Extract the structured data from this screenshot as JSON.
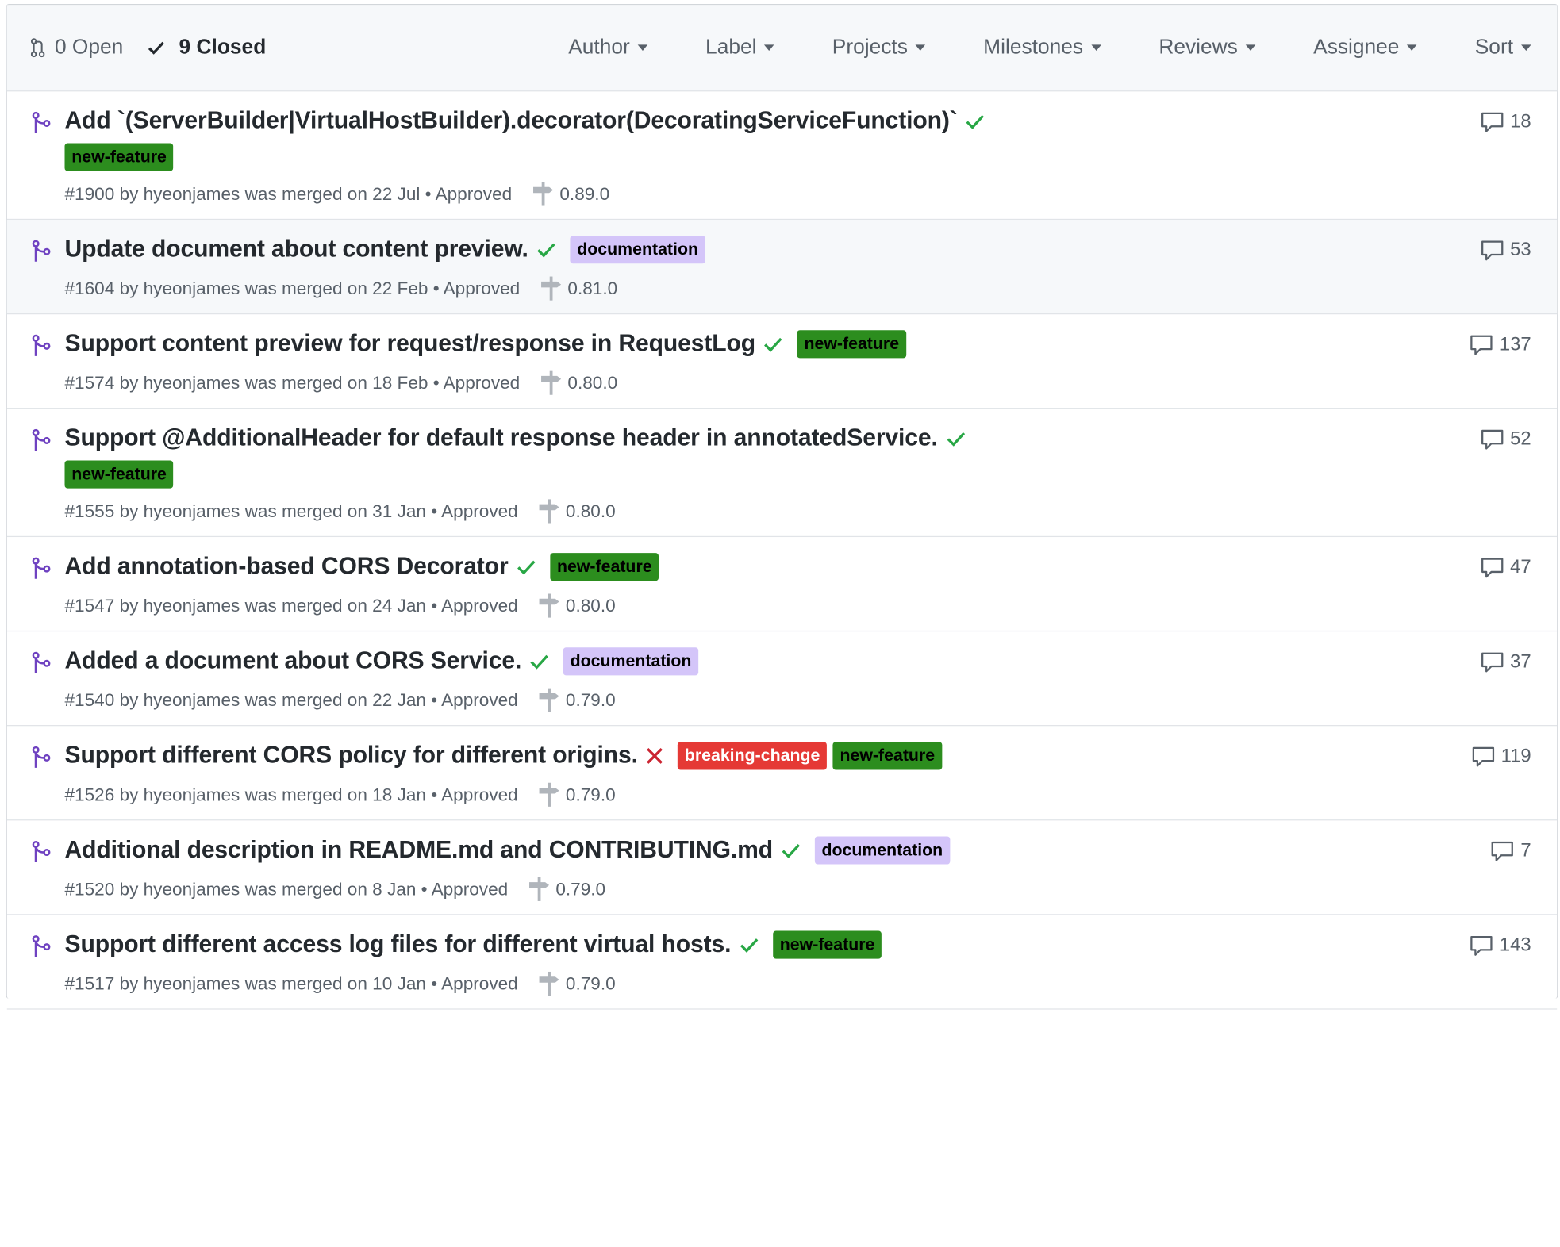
{
  "header": {
    "open_label": "0 Open",
    "closed_label": "9 Closed",
    "filters": [
      "Author",
      "Label",
      "Projects",
      "Milestones",
      "Reviews",
      "Assignee",
      "Sort"
    ]
  },
  "colors": {
    "merged_icon": "#6f42c1",
    "check": "#28a745",
    "fail": "#cb2431",
    "label_new_feature": "#2c8d1e",
    "label_documentation": "#d4c5f9",
    "label_breaking_change": "#e53935"
  },
  "pull_requests": [
    {
      "title": "Add `(ServerBuilder|VirtualHostBuilder).decorator(DecoratingServiceFunction)`",
      "status": "success",
      "labels": [
        "new-feature"
      ],
      "meta": "#1900 by hyeonjames was merged on 22 Jul • Approved",
      "milestone": "0.89.0",
      "comments": "18"
    },
    {
      "title": "Update document about content preview.",
      "status": "success",
      "labels": [
        "documentation"
      ],
      "meta": "#1604 by hyeonjames was merged on 22 Feb • Approved",
      "milestone": "0.81.0",
      "comments": "53"
    },
    {
      "title": "Support content preview for request/response in RequestLog",
      "status": "success",
      "labels": [
        "new-feature"
      ],
      "meta": "#1574 by hyeonjames was merged on 18 Feb • Approved",
      "milestone": "0.80.0",
      "comments": "137"
    },
    {
      "title": "Support @AdditionalHeader for default response header in annotatedService.",
      "status": "success",
      "labels": [
        "new-feature"
      ],
      "meta": "#1555 by hyeonjames was merged on 31 Jan • Approved",
      "milestone": "0.80.0",
      "comments": "52"
    },
    {
      "title": "Add annotation-based CORS Decorator",
      "status": "success",
      "labels": [
        "new-feature"
      ],
      "meta": "#1547 by hyeonjames was merged on 24 Jan • Approved",
      "milestone": "0.80.0",
      "comments": "47"
    },
    {
      "title": "Added a document about CORS Service.",
      "status": "success",
      "labels": [
        "documentation"
      ],
      "meta": "#1540 by hyeonjames was merged on 22 Jan • Approved",
      "milestone": "0.79.0",
      "comments": "37"
    },
    {
      "title": "Support different CORS policy for different origins.",
      "status": "failure",
      "labels": [
        "breaking-change",
        "new-feature"
      ],
      "meta": "#1526 by hyeonjames was merged on 18 Jan • Approved",
      "milestone": "0.79.0",
      "comments": "119"
    },
    {
      "title": "Additional description in README.md and CONTRIBUTING.md",
      "status": "success",
      "labels": [
        "documentation"
      ],
      "meta": "#1520 by hyeonjames was merged on 8 Jan • Approved",
      "milestone": "0.79.0",
      "comments": "7"
    },
    {
      "title": "Support different access log files for different virtual hosts.",
      "status": "success",
      "labels": [
        "new-feature"
      ],
      "meta": "#1517 by hyeonjames was merged on 10 Jan • Approved",
      "milestone": "0.79.0",
      "comments": "143"
    }
  ]
}
